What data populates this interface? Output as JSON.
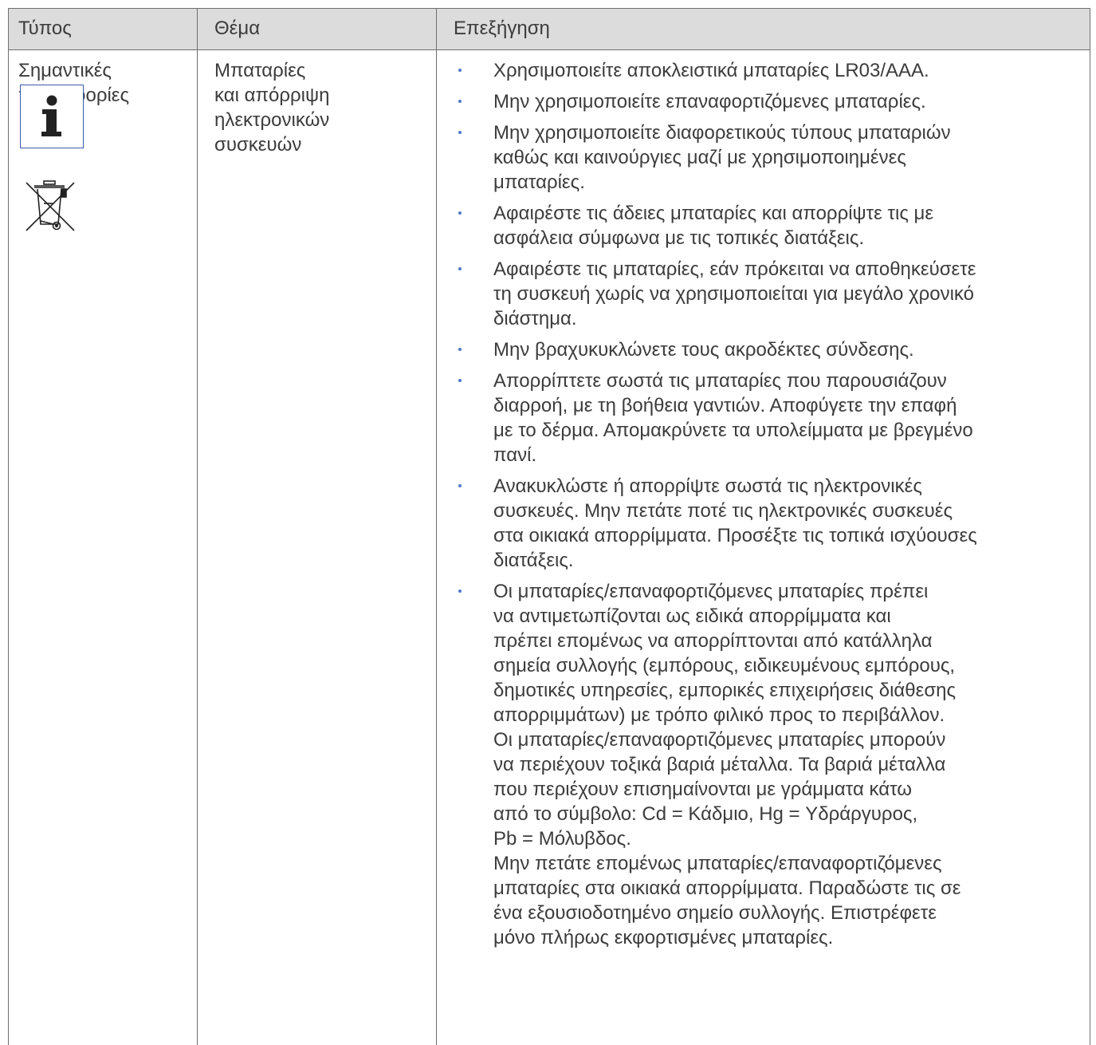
{
  "table": {
    "headers": {
      "type": "Τύπος",
      "topic": "Θέμα",
      "explanation": "Επεξήγηση"
    },
    "row": {
      "type_lines": [
        "Σημαντικές",
        "πληροφορίες"
      ],
      "info_icon_letter": "i",
      "icons": [
        "info-icon",
        "crossed-out-wheelie-bin-icon"
      ],
      "topic_lines": [
        "Μπαταρίες",
        "και απόρριψη",
        "ηλεκτρονικών",
        "συσκευών"
      ],
      "bullets": [
        {
          "lines": [
            "Χρησιμοποιείτε αποκλειστικά μπαταρίες LR03/AAA."
          ]
        },
        {
          "lines": [
            "Μην χρησιμοποιείτε επαναφορτιζόμενες μπαταρίες."
          ]
        },
        {
          "lines": [
            "Μην χρησιμοποιείτε διαφορετικούς τύπους μπαταριών",
            "καθώς και καινούργιες μαζί με χρησιμοποιημένες",
            "μπαταρίες."
          ]
        },
        {
          "lines": [
            "Αφαιρέστε τις άδειες μπαταρίες και απορρίψτε τις με",
            "ασφάλεια σύμφωνα με τις τοπικές διατάξεις."
          ]
        },
        {
          "lines": [
            "Αφαιρέστε τις μπαταρίες, εάν πρόκειται να αποθηκεύσετε",
            "τη συσκευή χωρίς να χρησιμοποιείται για μεγάλο χρονικό",
            "διάστημα."
          ]
        },
        {
          "lines": [
            "Μην βραχυκυκλώνετε τους ακροδέκτες σύνδεσης."
          ]
        },
        {
          "lines": [
            "Απορρίπτετε σωστά τις μπαταρίες που παρουσιάζουν",
            "διαρροή, με τη βοήθεια γαντιών. Αποφύγετε την επαφή",
            "με το δέρμα. Απομακρύνετε τα υπολείμματα με βρεγμένο",
            "πανί."
          ]
        },
        {
          "lines": [
            "Ανακυκλώστε ή απορρίψτε σωστά τις ηλεκτρονικές",
            "συσκευές. Μην πετάτε ποτέ τις ηλεκτρονικές συσκευές",
            "στα οικιακά απορρίμματα. Προσέξτε τις τοπικά ισχύουσες",
            "διατάξεις."
          ]
        },
        {
          "lines": [
            "Οι μπαταρίες/επαναφορτιζόμενες μπαταρίες πρέπει",
            "να αντιμετωπίζονται ως ειδικά απορρίμματα και",
            "πρέπει επομένως να απορρίπτονται από κατάλληλα",
            "σημεία συλλογής (εμπόρους, ειδικευμένους εμπόρους,",
            "δημοτικές υπηρεσίες, εμπορικές επιχειρήσεις διάθεσης",
            "απορριμμάτων) με τρόπο φιλικό προς το περιβάλλον.",
            "Οι μπαταρίες/επαναφορτιζόμενες μπαταρίες μπορούν",
            "να περιέχουν τοξικά βαριά μέταλλα. Τα βαριά μέταλλα",
            "που περιέχουν επισημαίνονται με γράμματα κάτω",
            "από το σύμβολο: Cd = Κάδμιο, Hg = Υδράργυρος,",
            "Pb = Μόλυβδος.",
            "Μην πετάτε επομένως μπαταρίες/επαναφορτιζόμενες",
            "μπαταρίες στα οικιακά απορρίμματα. Παραδώστε τις σε",
            "ένα εξουσιοδοτημένο σημείο συλλογής. Επιστρέφετε",
            "μόνο πλήρως εκφορτισμένες μπαταρίες."
          ]
        }
      ]
    },
    "colors": {
      "header_bg": "#dcdcdc",
      "border": "#6f6f6f",
      "text": "#3c3c3c",
      "bullet": "#4f78c8",
      "icon_frame": "#3a5aa7"
    }
  }
}
